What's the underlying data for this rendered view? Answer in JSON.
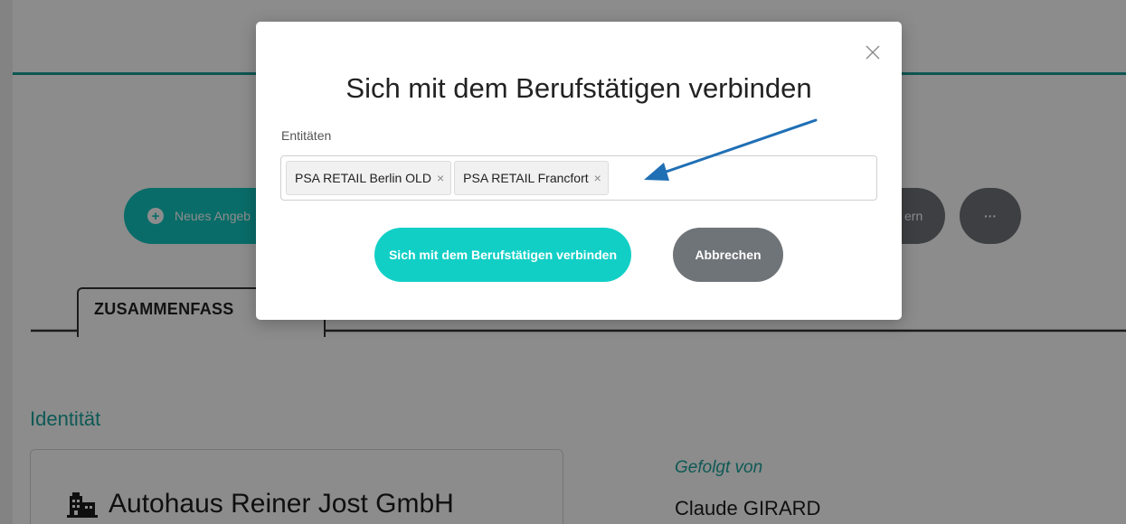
{
  "background": {
    "action_button_label": "Neues Angeb",
    "right_pill_label": "ern",
    "more_label": "···",
    "tab_label": "ZUSAMMENFASS",
    "section_title": "Identität",
    "company_name": "Autohaus Reiner Jost GmbH",
    "company_icon": "building-icon",
    "followed_by_label": "Gefolgt von",
    "followed_by_value": "Claude GIRARD"
  },
  "modal": {
    "title": "Sich mit dem Berufstätigen verbinden",
    "close_icon": "close-icon",
    "field_label": "Entitäten",
    "tags": [
      {
        "label": "PSA RETAIL Berlin OLD",
        "remove": "×"
      },
      {
        "label": "PSA RETAIL Francfort",
        "remove": "×"
      }
    ],
    "confirm_label": "Sich mit dem Berufstätigen verbinden",
    "cancel_label": "Abbrechen"
  },
  "annotation": {
    "arrow_color": "#1f6fb5"
  },
  "colors": {
    "accent": "#12cfc6",
    "teal_text": "#1aa39c",
    "secondary_button": "#6f7479"
  }
}
